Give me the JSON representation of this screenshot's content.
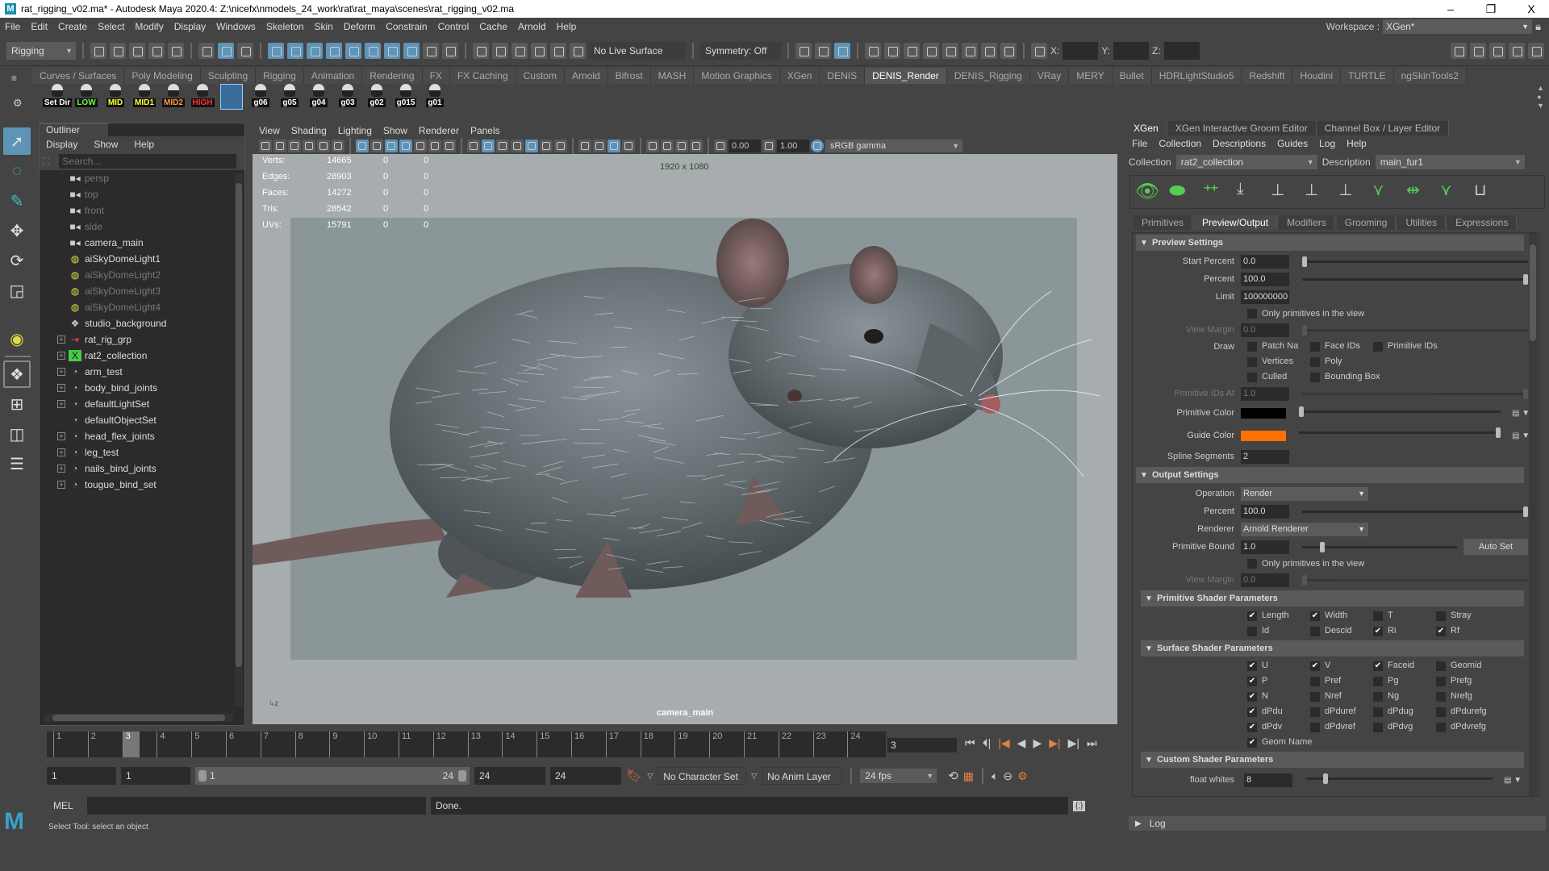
{
  "window": {
    "title": "rat_rigging_v02.ma* - Autodesk Maya 2020.4: Z:\\nicefx\\nmodels_24_work\\rat\\rat_maya\\scenes\\rat_rigging_v02.ma",
    "logo": "M",
    "minimize": "–",
    "maximize": "❐",
    "close": "X"
  },
  "menubar": [
    "File",
    "Edit",
    "Create",
    "Select",
    "Modify",
    "Display",
    "Windows",
    "Skeleton",
    "Skin",
    "Deform",
    "Constrain",
    "Control",
    "Cache",
    "Arnold",
    "Help"
  ],
  "workspace": {
    "label": "Workspace :",
    "value": "XGen*"
  },
  "status_line": {
    "menu_set": "Rigging",
    "live_surface": "No Live Surface",
    "symmetry": "Symmetry: Off",
    "x": "X:",
    "y": "Y:",
    "z": "Z:"
  },
  "shelf": {
    "tabs": [
      "Curves / Surfaces",
      "Poly Modeling",
      "Sculpting",
      "Rigging",
      "Animation",
      "Rendering",
      "FX",
      "FX Caching",
      "Custom",
      "Arnold",
      "Bifrost",
      "MASH",
      "Motion Graphics",
      "XGen",
      "DENIS",
      "DENIS_Render",
      "DENIS_Rigging",
      "VRay",
      "MERY",
      "Bullet",
      "HDRLightStudio5",
      "Redshift",
      "Houdini",
      "TURTLE",
      "ngSkinTools2"
    ],
    "active_tab": "DENIS_Render",
    "buttons": [
      {
        "label": "Set Dir",
        "color": "#ffffff"
      },
      {
        "label": "LOW",
        "color": "#66ff33"
      },
      {
        "label": "MID",
        "color": "#ffff33"
      },
      {
        "label": "MID1",
        "color": "#ffff33"
      },
      {
        "label": "MID2",
        "color": "#ff9933"
      },
      {
        "label": "HIGH",
        "color": "#ff3333"
      },
      {
        "label": "",
        "color": "#ffffff"
      },
      {
        "label": "g06",
        "color": "#ffffff"
      },
      {
        "label": "g05",
        "color": "#ffffff"
      },
      {
        "label": "g04",
        "color": "#ffffff"
      },
      {
        "label": "g03",
        "color": "#ffffff"
      },
      {
        "label": "g02",
        "color": "#ffffff"
      },
      {
        "label": "g015",
        "color": "#ffffff"
      },
      {
        "label": "g01",
        "color": "#ffffff"
      }
    ]
  },
  "outliner": {
    "title": "Outliner",
    "menu": [
      "Display",
      "Show",
      "Help"
    ],
    "search_placeholder": "Search...",
    "items": [
      {
        "name": "persp",
        "icon": "camera-icon",
        "dim": true,
        "expand": false
      },
      {
        "name": "top",
        "icon": "camera-icon",
        "dim": true,
        "expand": false
      },
      {
        "name": "front",
        "icon": "camera-icon",
        "dim": true,
        "expand": false
      },
      {
        "name": "side",
        "icon": "camera-icon",
        "dim": true,
        "expand": false
      },
      {
        "name": "camera_main",
        "icon": "camera-icon",
        "dim": false,
        "expand": false
      },
      {
        "name": "aiSkyDomeLight1",
        "icon": "skydome-icon",
        "dim": false,
        "expand": false
      },
      {
        "name": "aiSkyDomeLight2",
        "icon": "skydome-icon",
        "dim": true,
        "expand": false
      },
      {
        "name": "aiSkyDomeLight3",
        "icon": "skydome-icon",
        "dim": true,
        "expand": false
      },
      {
        "name": "aiSkyDomeLight4",
        "icon": "skydome-icon",
        "dim": true,
        "expand": false
      },
      {
        "name": "studio_background",
        "icon": "mesh-icon",
        "dim": false,
        "expand": false
      },
      {
        "name": "rat_rig_grp",
        "icon": "group-icon",
        "dim": false,
        "expand": true
      },
      {
        "name": "rat2_collection",
        "icon": "xgen-icon",
        "dim": false,
        "expand": true
      },
      {
        "name": "arm_test",
        "icon": "set-icon",
        "dim": false,
        "expand": true
      },
      {
        "name": "body_bind_joints",
        "icon": "set-icon",
        "dim": false,
        "expand": true
      },
      {
        "name": "defaultLightSet",
        "icon": "set-icon",
        "dim": false,
        "expand": true
      },
      {
        "name": "defaultObjectSet",
        "icon": "set-icon",
        "dim": false,
        "expand": false
      },
      {
        "name": "head_flex_joints",
        "icon": "set-icon",
        "dim": false,
        "expand": true
      },
      {
        "name": "leg_test",
        "icon": "set-icon",
        "dim": false,
        "expand": true
      },
      {
        "name": "nails_bind_joints",
        "icon": "set-icon",
        "dim": false,
        "expand": true
      },
      {
        "name": "tougue_bind_set",
        "icon": "set-icon",
        "dim": false,
        "expand": true
      }
    ]
  },
  "viewport": {
    "menu": [
      "View",
      "Shading",
      "Lighting",
      "Show",
      "Renderer",
      "Panels"
    ],
    "exposure": "0.00",
    "gamma": "1.00",
    "color_space": "sRGB gamma",
    "hud": [
      [
        "Verts:",
        "14665",
        "0",
        "0"
      ],
      [
        "Edges:",
        "28903",
        "0",
        "0"
      ],
      [
        "Faces:",
        "14272",
        "0",
        "0"
      ],
      [
        "Tris:",
        "28542",
        "0",
        "0"
      ],
      [
        "UVs:",
        "15791",
        "0",
        "0"
      ]
    ],
    "resolution": "1920 x 1080",
    "camera": "camera_main"
  },
  "xgen": {
    "panel_tabs": [
      "XGen",
      "XGen Interactive Groom Editor",
      "Channel Box / Layer Editor"
    ],
    "menu": [
      "File",
      "Collection",
      "Descriptions",
      "Guides",
      "Log",
      "Help"
    ],
    "collection_label": "Collection",
    "collection": "rat2_collection",
    "description_label": "Description",
    "description": "main_fur1",
    "sub_tabs": [
      "Primitives",
      "Preview/Output",
      "Modifiers",
      "Grooming",
      "Utilities",
      "Expressions"
    ],
    "preview": {
      "title": "Preview Settings",
      "start_percent_label": "Start Percent",
      "start_percent": "0.0",
      "start_percent_value": 0,
      "percent_label": "Percent",
      "percent": "100.0",
      "percent_value": 100,
      "limit_label": "Limit",
      "limit": "100000000",
      "only_view": "Only primitives in the view",
      "view_margin_label": "View Margin",
      "view_margin": "0.0",
      "draw_label": "Draw",
      "draw": [
        {
          "label": "Patch Na",
          "checked": false
        },
        {
          "label": "Face IDs",
          "checked": false
        },
        {
          "label": "Primitive IDs",
          "checked": false
        },
        {
          "label": "Vertices",
          "checked": false
        },
        {
          "label": "Poly",
          "checked": false
        },
        {
          "label": "Culled",
          "checked": false
        },
        {
          "label": "Bounding Box",
          "checked": false
        }
      ],
      "prim_ids_at_label": "Primitive IDs At",
      "prim_ids_at": "1.0",
      "prim_color_label": "Primitive Color",
      "prim_color": "#000000",
      "guide_color_label": "Guide Color",
      "guide_color": "#ff7000",
      "spline_label": "Spline Segments",
      "spline": "2"
    },
    "output": {
      "title": "Output Settings",
      "operation_label": "Operation",
      "operation": "Render",
      "percent_label": "Percent",
      "percent": "100.0",
      "renderer_label": "Renderer",
      "renderer": "Arnold Renderer",
      "bound_label": "Primitive Bound",
      "bound": "1.0",
      "auto_set": "Auto Set",
      "only_view": "Only primitives in the view",
      "view_margin_label": "View Margin",
      "view_margin": "0.0"
    },
    "prim_shader": {
      "title": "Primitive Shader Parameters",
      "items": [
        {
          "label": "Length",
          "checked": true
        },
        {
          "label": "Width",
          "checked": true
        },
        {
          "label": "T",
          "checked": false
        },
        {
          "label": "Stray",
          "checked": false
        },
        {
          "label": "Id",
          "checked": false
        },
        {
          "label": "Descid",
          "checked": false
        },
        {
          "label": "Ri",
          "checked": true
        },
        {
          "label": "Rf",
          "checked": true
        }
      ]
    },
    "surf_shader": {
      "title": "Surface Shader Parameters",
      "items": [
        {
          "label": "U",
          "checked": true
        },
        {
          "label": "V",
          "checked": true
        },
        {
          "label": "Faceid",
          "checked": true
        },
        {
          "label": "Geomid",
          "checked": false
        },
        {
          "label": "P",
          "checked": true
        },
        {
          "label": "Pref",
          "checked": false
        },
        {
          "label": "Pg",
          "checked": false
        },
        {
          "label": "Prefg",
          "checked": false
        },
        {
          "label": "N",
          "checked": true
        },
        {
          "label": "Nref",
          "checked": false
        },
        {
          "label": "Ng",
          "checked": false
        },
        {
          "label": "Nrefg",
          "checked": false
        },
        {
          "label": "dPdu",
          "checked": true
        },
        {
          "label": "dPduref",
          "checked": false
        },
        {
          "label": "dPdug",
          "checked": false
        },
        {
          "label": "dPdurefg",
          "checked": false
        },
        {
          "label": "dPdv",
          "checked": true
        },
        {
          "label": "dPdvref",
          "checked": false
        },
        {
          "label": "dPdvg",
          "checked": false
        },
        {
          "label": "dPdvrefg",
          "checked": false
        },
        {
          "label": "Geom Name",
          "checked": true
        }
      ]
    },
    "custom_shader": {
      "title": "Custom Shader Parameters",
      "float_label": "float whites",
      "float_value": "8"
    },
    "log": "Log"
  },
  "timeline": {
    "ticks": [
      "1",
      "2",
      "3",
      "4",
      "5",
      "6",
      "7",
      "8",
      "9",
      "10",
      "11",
      "12",
      "13",
      "14",
      "15",
      "16",
      "17",
      "18",
      "19",
      "20",
      "21",
      "22",
      "23",
      "24"
    ],
    "current": "3",
    "current_field": "3"
  },
  "range": {
    "anim_start": "1",
    "play_start": "1",
    "slider_start": "1",
    "slider_end": "24",
    "play_end": "24",
    "anim_end": "24",
    "character_set": "No Character Set",
    "anim_layer": "No Anim Layer",
    "fps": "24 fps"
  },
  "command": {
    "lang": "MEL",
    "result": "Done.",
    "help": "Select Tool: select an object"
  }
}
